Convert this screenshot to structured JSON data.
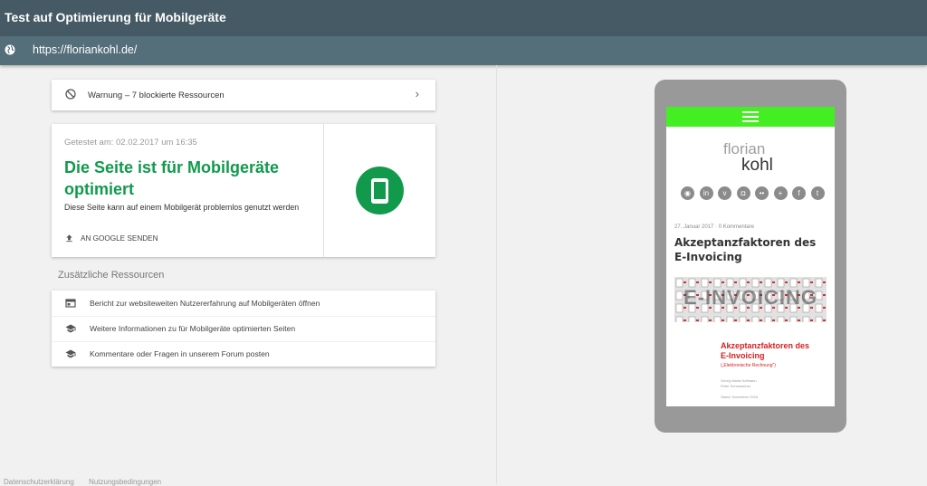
{
  "app": {
    "title": "Test auf Optimierung für Mobilgeräte"
  },
  "url": {
    "text": "https://floriankohl.de/"
  },
  "warning": {
    "label": "Warnung – 7 blockierte Ressourcen"
  },
  "result": {
    "date": "Getestet am: 02.02.2017 um 16:35",
    "headline": "Die Seite ist für Mobilgeräte optimiert",
    "description": "Diese Seite kann auf einem Mobilgerät problemlos genutzt werden",
    "send_label": "AN GOOGLE SENDEN",
    "accent": "#119a4c"
  },
  "resources": {
    "title": "Zusätzliche Ressourcen",
    "items": [
      {
        "label": "Bericht zur websiteweiten Nutzererfahrung auf Mobilgeräten öffnen",
        "icon": "browser-window-icon"
      },
      {
        "label": "Weitere Informationen zu für Mobilgeräte optimierten Seiten",
        "icon": "graduation-cap-icon"
      },
      {
        "label": "Kommentare oder Fragen in unserem Forum posten",
        "icon": "graduation-cap-icon"
      }
    ]
  },
  "footer": {
    "links": [
      "Datenschutzerklärung",
      "Nutzungsbedingungen"
    ]
  },
  "preview": {
    "logo_top": "florian",
    "logo_bottom": "kohl",
    "social_icons": [
      "rss-icon",
      "linkedin-icon",
      "vimeo-icon",
      "instagram-icon",
      "flickr-icon",
      "google-plus-icon",
      "facebook-icon",
      "twitter-icon"
    ],
    "social_glyphs": [
      "◉",
      "in",
      "v",
      "◘",
      "••",
      "+",
      "f",
      "t"
    ],
    "post_meta": "27. Januar 2017 · 0 Kommentare",
    "post_title": "Akzeptanzfaktoren des E-Invoicing",
    "banner_text": "E-INVOICING",
    "doc_title": "Akzeptanzfaktoren des E-Invoicing",
    "doc_subtitle": "(„Elektronische Rechnung\")",
    "doc_authors": "Georg Maria Hofmann\nPeter Schumacher",
    "doc_date": "Stand: November 2016",
    "topbar_color": "#44ee22"
  }
}
